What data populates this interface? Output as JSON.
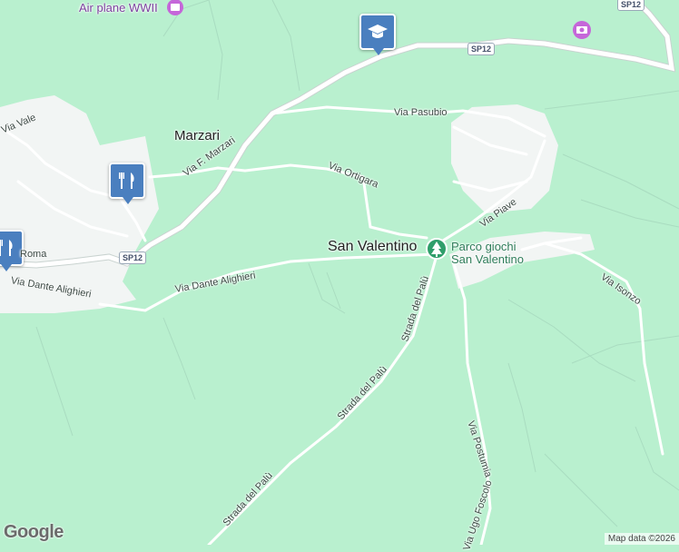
{
  "map": {
    "colors": {
      "land": "#b9f0cf",
      "built": "#f2f5f4",
      "road": "#ffffff",
      "road_edge": "#c9d3d0",
      "water": "#aadaff",
      "poi_green": "#2f9e6a",
      "marker_blue": "#4a7fbf",
      "poi_purple": "#c566d9"
    },
    "places": {
      "marzari": "Marzari",
      "san_valentino": "San Valentino"
    },
    "pois": {
      "air_plane": "Air plane WWII",
      "parco": "Parco giochi\nSan Valentino"
    },
    "roads": {
      "via_vale": "Via Vale",
      "via_pasubio": "Via Pasubio",
      "via_f_marzari": "Via F. Marzari",
      "via_ortigara": "Via Ortigara",
      "via_piave": "Via Piave",
      "via_roma": "Roma",
      "via_dante": "Via Dante Alighieri",
      "via_isonzo": "Via Isonzo",
      "strada_palu_1": "Strada del Palù",
      "strada_palu_2": "Strada del Palù",
      "strada_palu_3": "Strada del Palù",
      "via_postumia": "Via Postumia",
      "via_ugo_foscolo": "Via Ugo Foscolo"
    },
    "shields": {
      "sp12_top": "SP12",
      "sp12_left": "SP12",
      "sp12_corner": "SP12"
    },
    "icons": {
      "school": "school-icon",
      "restaurant": "restaurant-icon",
      "museum": "museum-icon",
      "playground": "tree-icon"
    },
    "footer": {
      "copyright": "Map data ©2026",
      "brand": "Google"
    }
  }
}
